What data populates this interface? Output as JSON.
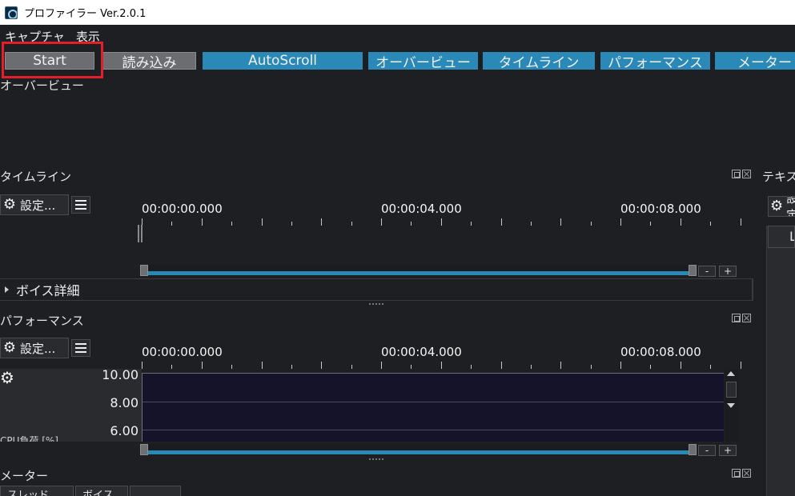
{
  "window": {
    "title": "プロファイラー Ver.2.0.1",
    "icon": "app-profiler-icon"
  },
  "menu": {
    "items": [
      "キャプチャ",
      "表示"
    ]
  },
  "toolbar": {
    "buttons": [
      {
        "label": "Start"
      },
      {
        "label": "読み込み"
      },
      {
        "label": "AutoScroll"
      },
      {
        "label": "オーバービュー"
      },
      {
        "label": "タイムライン"
      },
      {
        "label": "パフォーマンス"
      },
      {
        "label": "メーター"
      }
    ]
  },
  "overview": {
    "title": "オーバービュー"
  },
  "timeline": {
    "title": "タイムライン",
    "settings_label": "設定...",
    "time_labels": [
      "00:00:00.000",
      "00:00:04.000",
      "00:00:08.000"
    ],
    "zoom_out": "-",
    "zoom_in": "+",
    "voice_detail": "ボイス詳細"
  },
  "performance": {
    "title": "パフォーマンス",
    "settings_label": "設定...",
    "time_labels": [
      "00:00:00.000",
      "00:00:04.000",
      "00:00:08.000"
    ],
    "y_values": [
      "10.00",
      "8.00",
      "6.00"
    ],
    "series_label": "CPU負荷 [%]",
    "zoom_out": "-",
    "zoom_in": "+"
  },
  "meter": {
    "title": "メーター",
    "tabs": [
      "スレッド",
      "ボイス",
      ""
    ]
  },
  "text_panel": {
    "title": "テキスト",
    "settings_label": "設定...",
    "tab_label": "L"
  },
  "colors": {
    "accent": "#2a89b6",
    "highlight": "#e3202a",
    "background": "#1e1f22"
  }
}
